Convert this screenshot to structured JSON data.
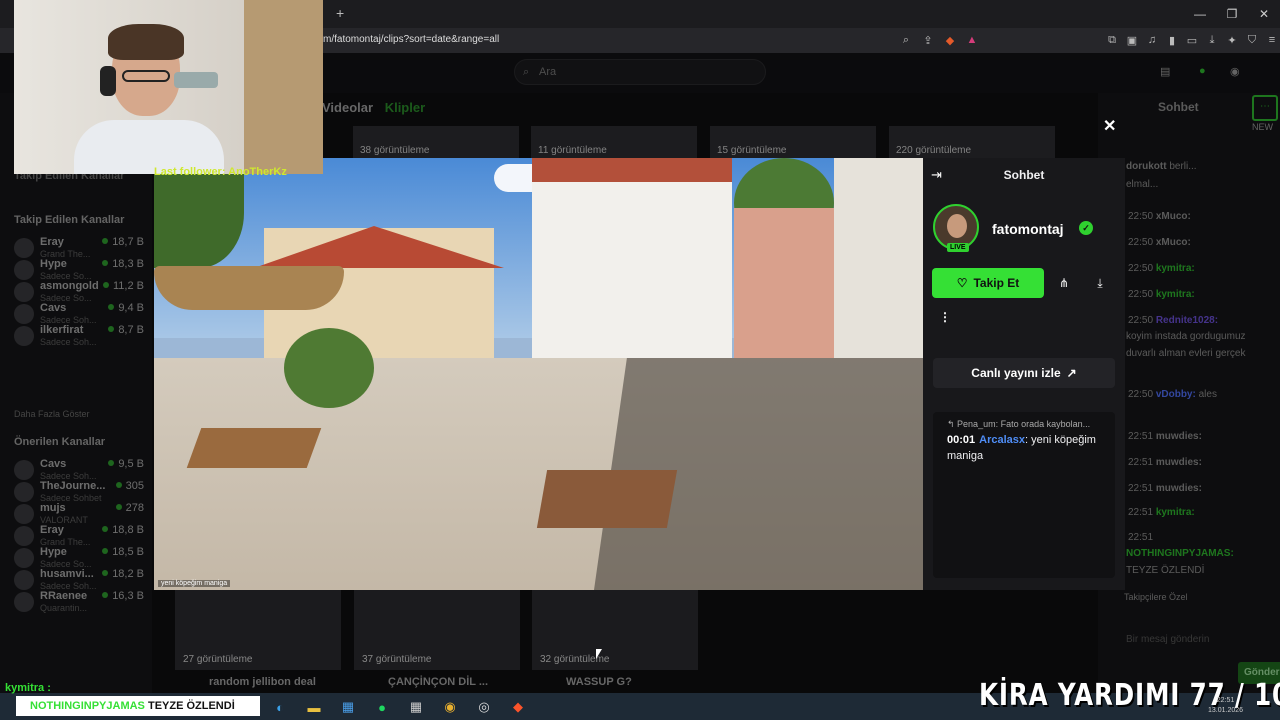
{
  "browser": {
    "url": "m/fatomontaj/clips?sort=date&range=all",
    "new_tab": "+",
    "window_controls": [
      "—",
      "❐",
      "✕"
    ]
  },
  "topnav": {
    "search_placeholder": "Ara"
  },
  "channel_tabs": {
    "videos": "Videolar",
    "clips": "Klipler"
  },
  "sidebar": {
    "followed_title_ghost": "Takip Edilen Kanallar",
    "followed_title": "Takip Edilen Kanallar",
    "followed": [
      {
        "name": "Eray",
        "sub": "Grand The...",
        "count": "18,7 B"
      },
      {
        "name": "Hype",
        "sub": "Sadece So...",
        "count": "18,3 B"
      },
      {
        "name": "asmongold",
        "sub": "Sadece So...",
        "count": "11,2 B"
      },
      {
        "name": "Cavs",
        "sub": "Sadece Soh...",
        "count": "9,4 B"
      },
      {
        "name": "ilkerfirat",
        "sub": "Sadece Soh...",
        "count": "8,7 B"
      }
    ],
    "show_more": "Daha Fazla Göster",
    "suggested_title": "Önerilen Kanallar",
    "suggested": [
      {
        "name": "Cavs",
        "sub": "Sadece Soh...",
        "count": "9,5 B"
      },
      {
        "name": "TheJourne...",
        "sub": "Sadece Sohbet",
        "count": "305"
      },
      {
        "name": "mujs",
        "sub": "VALORANT",
        "count": "278"
      },
      {
        "name": "Eray",
        "sub": "Grand The...",
        "count": "18,8 B"
      },
      {
        "name": "Hype",
        "sub": "Sadece So...",
        "count": "18,5 B"
      },
      {
        "name": "husamvi...",
        "sub": "Sadece Soh...",
        "count": "18,2 B"
      },
      {
        "name": "RRaenee",
        "sub": "Quarantin...",
        "count": "16,3 B"
      }
    ]
  },
  "clips_top": [
    "38 görüntüleme",
    "11 görüntüleme",
    "15 görüntüleme",
    "220 görüntüleme"
  ],
  "clips_bottom": [
    {
      "views": "27 görüntüleme",
      "title": "random jellibon deal"
    },
    {
      "views": "37 görüntüleme",
      "title": "ÇANÇİNÇON DİL ..."
    },
    {
      "views": "32 görüntüleme",
      "title": "WASSUP G?"
    }
  ],
  "right_chat": {
    "title": "Sohbet",
    "new_label": "NEW",
    "lines": [
      {
        "time": "",
        "user": "dorukott",
        "text": "berli..."
      },
      {
        "time": "",
        "user": "",
        "text": "elmal..."
      },
      {
        "time": "22:50",
        "user": "xMuco:",
        "text": ""
      },
      {
        "time": "22:50",
        "user": "xMuco:",
        "text": ""
      },
      {
        "time": "22:50",
        "user": "kymitra:",
        "text": ""
      },
      {
        "time": "22:50",
        "user": "kymitra:",
        "text": ""
      },
      {
        "time": "22:50",
        "user": "Rednite1028:",
        "text": ""
      },
      {
        "time": "",
        "user": "",
        "text": "koyim instada gordugumuz"
      },
      {
        "time": "",
        "user": "",
        "text": "duvarlı alman evleri gerçek"
      },
      {
        "time": "22:50",
        "user": "vDobby:",
        "text": "ales"
      },
      {
        "time": "22:51",
        "user": "muwdies:",
        "text": ""
      },
      {
        "time": "22:51",
        "user": "muwdies:",
        "text": ""
      },
      {
        "time": "22:51",
        "user": "muwdies:",
        "text": ""
      },
      {
        "time": "22:51",
        "user": "kymitra:",
        "text": ""
      },
      {
        "time": "22:51",
        "user": "",
        "text": ""
      },
      {
        "time": "",
        "user": "NOTHINGINPYJAMAS:",
        "text": ""
      },
      {
        "time": "",
        "user": "",
        "text": "TEYZE ÖZLENDİ"
      }
    ],
    "input_placeholder": "Bir mesaj gönderin",
    "send_label": "Gönder",
    "subscribers_label": "Takipçilere Özel"
  },
  "modal": {
    "close": "✕",
    "video_caption": "yeni köpeğim maniga",
    "chat_title": "Sohbet",
    "channel_name": "fatomontaj",
    "live_badge": "LIVE",
    "follow_label": "Takip Et",
    "watch_live_label": "Canlı yayını izle",
    "reply_preview": "Pena_um: Fato orada kaybolan...",
    "message": {
      "time": "00:01",
      "user": "Arcalasx",
      "text": ": yeni köpeğim maniga"
    }
  },
  "stream_overlay": {
    "last_follower": "Last follower: AnoTherKz",
    "chat_line_user": "kymitra :",
    "ticker_user": "NOTHINGINPYJAMAS",
    "ticker_text": "TEYZE ÖZLENDİ",
    "goal": "KİRA YARDIMI 77 / 100",
    "clock_time": "22:51",
    "clock_date": "13.01.2026"
  },
  "colors": {
    "accent_green": "#35e035",
    "user_blue": "#4f8df5"
  }
}
